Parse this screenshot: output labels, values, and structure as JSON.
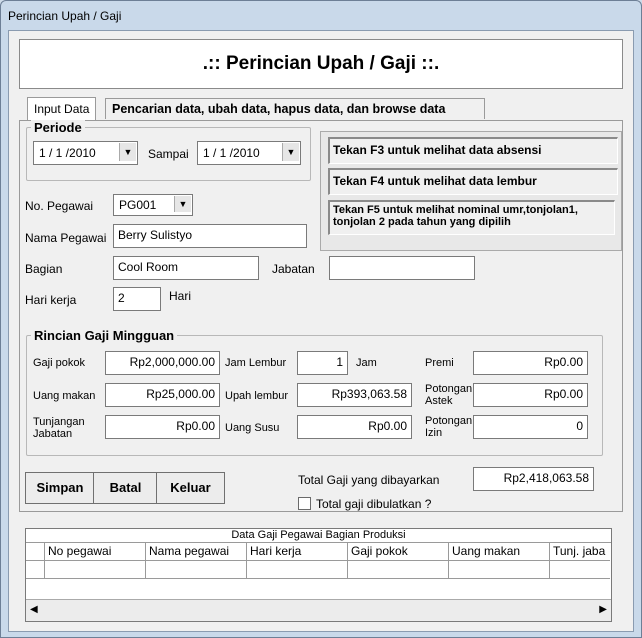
{
  "window": {
    "title": "Perincian Upah / Gaji"
  },
  "header": {
    "title": ".:: Perincian Upah / Gaji ::."
  },
  "tabs": [
    {
      "label": "Input Data"
    },
    {
      "label": "Pencarian data, ubah data, hapus data, dan  browse data"
    }
  ],
  "periode": {
    "legend": "Periode",
    "from_value": "1 / 1 /2010",
    "sampai_label": "Sampai",
    "to_value": "1 / 1 /2010"
  },
  "hints": [
    "Tekan F3 untuk melihat data absensi",
    "Tekan F4 untuk melihat data lembur",
    "Tekan F5 untuk melihat nominal umr,tonjolan1, tonjolan 2 pada tahun yang dipilih"
  ],
  "employee": {
    "no_label": "No. Pegawai",
    "no_value": "PG001",
    "nama_label": "Nama Pegawai",
    "nama_value": "Berry Sulistyo",
    "bagian_label": "Bagian",
    "bagian_value": "Cool Room",
    "jabatan_label": "Jabatan",
    "jabatan_value": "",
    "hari_label": "Hari kerja",
    "hari_value": "2",
    "hari_unit": "Hari"
  },
  "rincian": {
    "legend": "Rincian Gaji Mingguan",
    "gaji_pokok_label": "Gaji pokok",
    "gaji_pokok_value": "Rp2,000,000.00",
    "uang_makan_label": "Uang makan",
    "uang_makan_value": "Rp25,000.00",
    "tunjangan_label": "Tunjangan Jabatan",
    "tunjangan_value": "Rp0.00",
    "jam_lembur_label": "Jam Lembur",
    "jam_lembur_value": "1",
    "jam_unit": "Jam",
    "upah_lembur_label": "Upah lembur",
    "upah_lembur_value": "Rp393,063.58",
    "uang_susu_label": "Uang Susu",
    "uang_susu_value": "Rp0.00",
    "premi_label": "Premi",
    "premi_value": "Rp0.00",
    "pot_astek_label": "Potongan Astek",
    "pot_astek_value": "Rp0.00",
    "pot_izin_label": "Potongan Izin",
    "pot_izin_value": "0"
  },
  "actions": {
    "simpan": "Simpan",
    "batal": "Batal",
    "keluar": "Keluar"
  },
  "total": {
    "label": "Total Gaji yang dibayarkan",
    "value": "Rp2,418,063.58",
    "round_label": "Total gaji dibulatkan ?",
    "round_checked": false
  },
  "grid": {
    "caption": "Data Gaji Pegawai Bagian Produksi",
    "columns": [
      "No pegawai",
      "Nama pegawai",
      "Hari kerja",
      "Gaji pokok",
      "Uang makan",
      "Tunj. jaba"
    ]
  }
}
